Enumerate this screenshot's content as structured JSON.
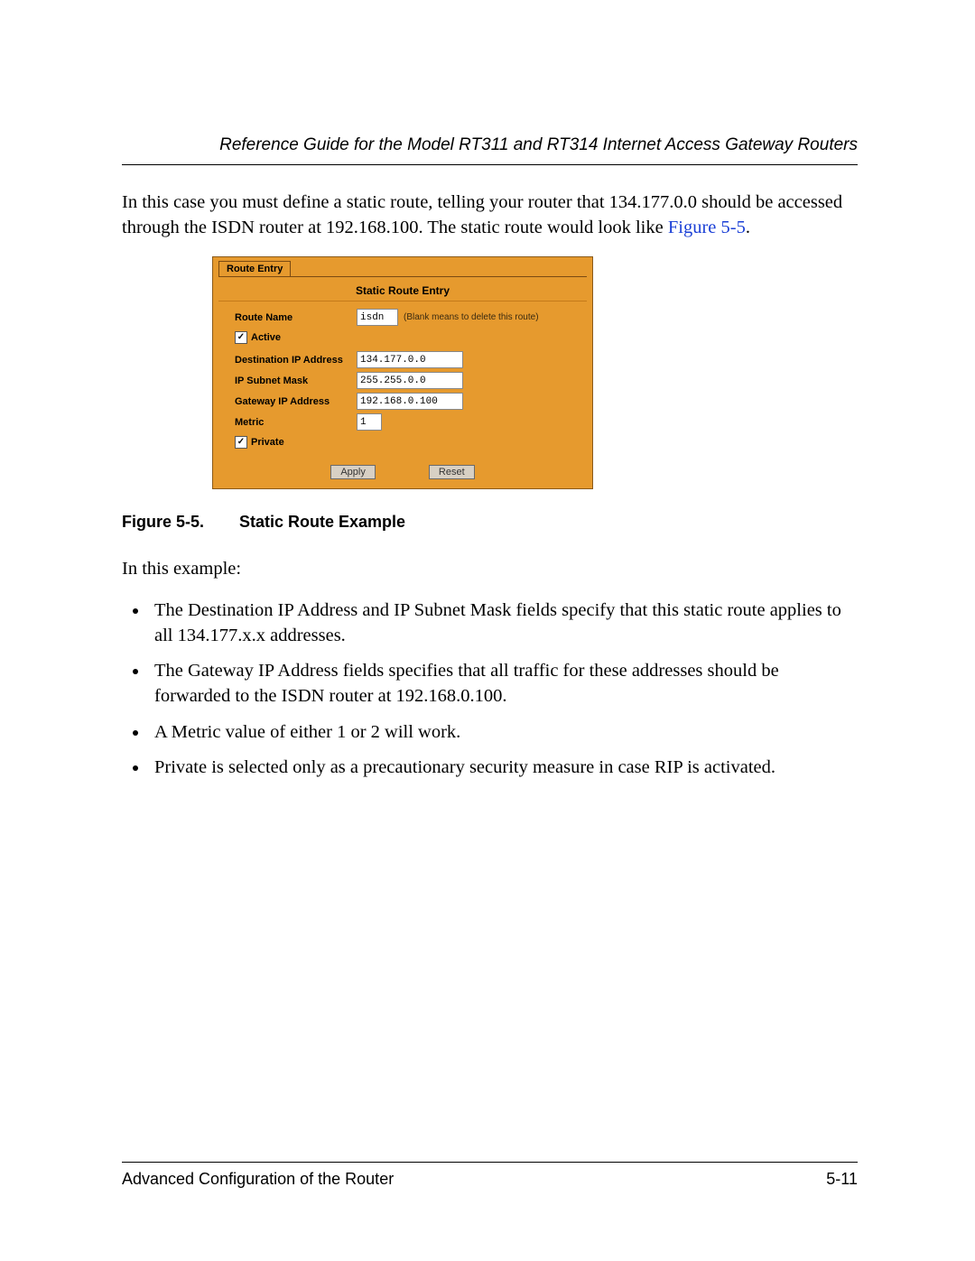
{
  "header": {
    "running_title": "Reference Guide for the Model RT311 and RT314 Internet Access Gateway Routers"
  },
  "paragraphs": {
    "intro_a": "In this case you must define a static route, telling your router that 134.177.0.0 should be accessed through the ISDN router at 192.168.100. The static route would look like ",
    "intro_figref": "Figure 5-5",
    "intro_b": ".",
    "after_fig": "In this example:"
  },
  "router_ui": {
    "tab": "Route Entry",
    "title": "Static Route Entry",
    "labels": {
      "route_name": "Route Name",
      "active": "Active",
      "dest_ip": "Destination IP Address",
      "subnet": "IP Subnet Mask",
      "gateway": "Gateway IP Address",
      "metric": "Metric",
      "private": "Private"
    },
    "values": {
      "route_name": "isdn",
      "hint": "(Blank means to delete this route)",
      "active_checked": "✓",
      "dest_ip": "134.177.0.0",
      "subnet": "255.255.0.0",
      "gateway": "192.168.0.100",
      "metric": "1",
      "private_checked": "✓"
    },
    "buttons": {
      "apply": "Apply",
      "reset": "Reset"
    }
  },
  "figure": {
    "number": "Figure 5-5.",
    "title": "Static Route Example"
  },
  "bullets": [
    "The Destination IP Address and IP Subnet Mask fields specify that this static route applies to all 134.177.x.x addresses.",
    "The Gateway IP Address fields specifies that all traffic for these addresses should be forwarded to the ISDN router at 192.168.0.100.",
    "A Metric value of either 1 or 2 will work.",
    "Private is selected only as a precautionary security measure in case RIP is activated."
  ],
  "footer": {
    "section": "Advanced Configuration of the Router",
    "page": "5-11"
  }
}
